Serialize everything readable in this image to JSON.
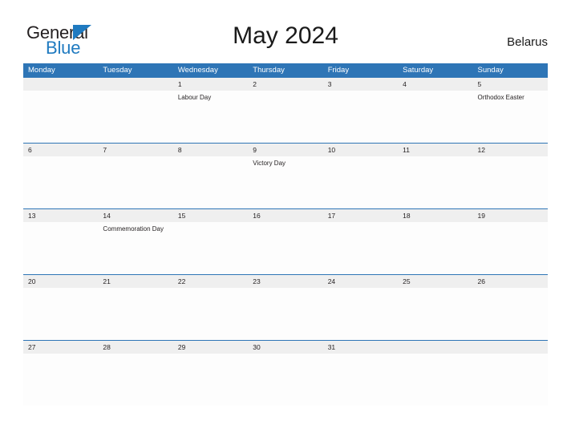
{
  "brand": {
    "name_part1": "General",
    "name_part2": "Blue",
    "flag_icon": "flag-triangle-icon",
    "accent_color": "#1f7ac0"
  },
  "header": {
    "title": "May 2024",
    "country": "Belarus"
  },
  "calendar": {
    "month": "May",
    "year": "2024",
    "header_bg_color": "#2e75b6",
    "daynum_band_color": "#efefef",
    "weekdays": [
      "Monday",
      "Tuesday",
      "Wednesday",
      "Thursday",
      "Friday",
      "Saturday",
      "Sunday"
    ],
    "weeks": [
      {
        "days": [
          {
            "num": "",
            "event": ""
          },
          {
            "num": "",
            "event": ""
          },
          {
            "num": "1",
            "event": "Labour Day"
          },
          {
            "num": "2",
            "event": ""
          },
          {
            "num": "3",
            "event": ""
          },
          {
            "num": "4",
            "event": ""
          },
          {
            "num": "5",
            "event": "Orthodox Easter"
          }
        ]
      },
      {
        "days": [
          {
            "num": "6",
            "event": ""
          },
          {
            "num": "7",
            "event": ""
          },
          {
            "num": "8",
            "event": ""
          },
          {
            "num": "9",
            "event": "Victory Day"
          },
          {
            "num": "10",
            "event": ""
          },
          {
            "num": "11",
            "event": ""
          },
          {
            "num": "12",
            "event": ""
          }
        ]
      },
      {
        "days": [
          {
            "num": "13",
            "event": ""
          },
          {
            "num": "14",
            "event": "Commemoration Day"
          },
          {
            "num": "15",
            "event": ""
          },
          {
            "num": "16",
            "event": ""
          },
          {
            "num": "17",
            "event": ""
          },
          {
            "num": "18",
            "event": ""
          },
          {
            "num": "19",
            "event": ""
          }
        ]
      },
      {
        "days": [
          {
            "num": "20",
            "event": ""
          },
          {
            "num": "21",
            "event": ""
          },
          {
            "num": "22",
            "event": ""
          },
          {
            "num": "23",
            "event": ""
          },
          {
            "num": "24",
            "event": ""
          },
          {
            "num": "25",
            "event": ""
          },
          {
            "num": "26",
            "event": ""
          }
        ]
      },
      {
        "days": [
          {
            "num": "27",
            "event": ""
          },
          {
            "num": "28",
            "event": ""
          },
          {
            "num": "29",
            "event": ""
          },
          {
            "num": "30",
            "event": ""
          },
          {
            "num": "31",
            "event": ""
          },
          {
            "num": "",
            "event": ""
          },
          {
            "num": "",
            "event": ""
          }
        ]
      }
    ]
  }
}
